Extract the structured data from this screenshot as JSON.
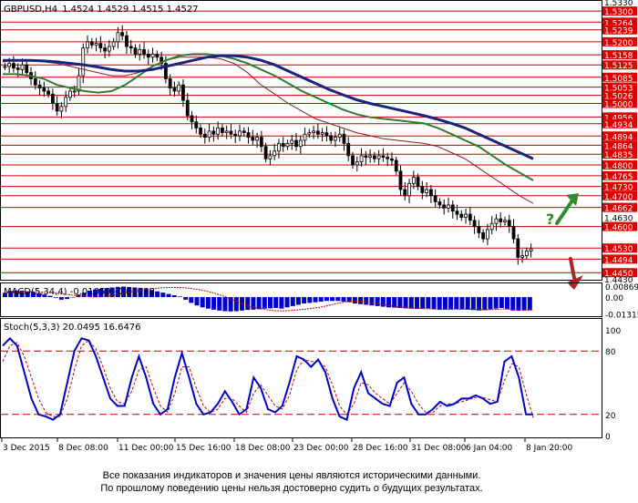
{
  "header": {
    "symbol": "GBPUSD,H4",
    "ohlc": "1.4524 1.4529 1.4515 1.4527"
  },
  "colors": {
    "frame": "#000000",
    "level_line": "#cc0000",
    "label_fill": "#dd0000",
    "label_text": "#ffffff",
    "candle": "#000000",
    "ma_fast": "#8b1a1a",
    "ma_mid": "#2e7d32",
    "ma_slow": "#1a237e",
    "macd_hist": "#0000cc",
    "macd_signal": "#cc0000",
    "stoch_main": "#0000cc",
    "stoch_signal": "#cc0000",
    "arrow_up": "#2e8b2e",
    "arrow_down": "#b22222"
  },
  "icons": {
    "up_forecast": "question-up-arrow-icon",
    "down_forecast": "down-arrow-icon"
  },
  "chart_data": [
    {
      "type": "candlestick",
      "title": "GBPUSD,H4",
      "ylim": [
        1.443,
        1.533
      ],
      "resistance_levels": [
        1.53,
        1.5264,
        1.5239,
        1.52,
        1.5158,
        1.5125,
        1.5085,
        1.5053,
        1.5026,
        1.5,
        1.4956,
        1.4934,
        1.4894,
        1.4864,
        1.4835,
        1.48,
        1.4765,
        1.473,
        1.47,
        1.4662,
        1.46,
        1.453,
        1.4494,
        1.445
      ],
      "price_labels": [
        "1.5330",
        "1.5300",
        "1.5264",
        "1.5239",
        "1.5200",
        "1.5158",
        "1.5125",
        "1.5085",
        "1.5053",
        "1.5026",
        "1.5000",
        "1.4956",
        "1.4934",
        "1.4894",
        "1.4864",
        "1.4835",
        "1.4800",
        "1.4765",
        "1.4730",
        "1.4700",
        "1.4662",
        "1.4630",
        "1.4600",
        "1.4530",
        "1.4494",
        "1.4450",
        "1.4430"
      ],
      "x_labels": [
        "3 Dec 2015",
        "8 Dec 08:00",
        "11 Dec 00:00",
        "15 Dec 16:00",
        "18 Dec 08:00",
        "23 Dec 00:00",
        "28 Dec 16:00",
        "31 Dec 08:00",
        "6 Jan 04:00",
        "8 Jan 20:00"
      ],
      "close_path": [
        1.512,
        1.513,
        1.5115,
        1.511,
        1.5125,
        1.51,
        1.508,
        1.506,
        1.505,
        1.504,
        1.503,
        1.5,
        1.4975,
        1.499,
        1.502,
        1.504,
        1.504,
        1.509,
        1.518,
        1.52,
        1.519,
        1.5195,
        1.518,
        1.517,
        1.5185,
        1.52,
        1.523,
        1.522,
        1.5185,
        1.518,
        1.516,
        1.5175,
        1.516,
        1.515,
        1.516,
        1.515,
        1.513,
        1.508,
        1.505,
        1.504,
        1.506,
        1.501,
        1.496,
        1.494,
        1.492,
        1.49,
        1.489,
        1.491,
        1.49,
        1.492,
        1.4905,
        1.491,
        1.49,
        1.4895,
        1.491,
        1.4905,
        1.489,
        1.488,
        1.489,
        1.486,
        1.482,
        1.483,
        1.4845,
        1.487,
        1.486,
        1.487,
        1.488,
        1.486,
        1.488,
        1.49,
        1.4905,
        1.491,
        1.49,
        1.4905,
        1.4895,
        1.488,
        1.489,
        1.49,
        1.487,
        1.483,
        1.48,
        1.481,
        1.483,
        1.4825,
        1.483,
        1.482,
        1.483,
        1.4825,
        1.482,
        1.4815,
        1.478,
        1.472,
        1.47,
        1.474,
        1.476,
        1.473,
        1.471,
        1.472,
        1.47,
        1.468,
        1.467,
        1.466,
        1.467,
        1.465,
        1.464,
        1.463,
        1.464,
        1.462,
        1.46,
        1.458,
        1.456,
        1.459,
        1.461,
        1.4625,
        1.4615,
        1.462,
        1.46,
        1.456,
        1.45,
        1.4505,
        1.452,
        1.4527
      ],
      "series": [
        {
          "name": "",
          "values": [
            1.5135,
            1.514,
            1.514,
            1.5135,
            1.513,
            1.512,
            1.511,
            1.51,
            1.509,
            1.509,
            1.51,
            1.512,
            1.514,
            1.515,
            1.515,
            1.515,
            1.5145,
            1.513,
            1.51,
            1.506,
            1.503,
            1.5,
            1.4975,
            1.495,
            1.4935,
            1.492,
            1.4905,
            1.4895,
            1.4885,
            1.488,
            1.4875,
            1.487,
            1.486,
            1.484,
            1.482,
            1.479,
            1.476,
            1.473,
            1.47,
            1.4675
          ]
        },
        {
          "name": "",
          "values": [
            1.5095,
            1.5095,
            1.509,
            1.508,
            1.506,
            1.505,
            1.504,
            1.5035,
            1.504,
            1.506,
            1.509,
            1.512,
            1.514,
            1.5155,
            1.516,
            1.516,
            1.5155,
            1.5145,
            1.513,
            1.511,
            1.509,
            1.5065,
            1.504,
            1.502,
            1.5,
            1.498,
            1.4965,
            1.4955,
            1.495,
            1.4945,
            1.494,
            1.4935,
            1.492,
            1.49,
            1.488,
            1.486,
            1.483,
            1.48,
            1.4775,
            1.475
          ]
        },
        {
          "name": "",
          "values": [
            1.514,
            1.514,
            1.514,
            1.5138,
            1.5135,
            1.513,
            1.5125,
            1.5118,
            1.511,
            1.5105,
            1.5105,
            1.511,
            1.512,
            1.513,
            1.514,
            1.515,
            1.5155,
            1.5155,
            1.515,
            1.514,
            1.5125,
            1.5105,
            1.5085,
            1.5065,
            1.5045,
            1.5028,
            1.5012,
            1.5,
            1.499,
            1.498,
            1.497,
            1.496,
            1.4948,
            1.4935,
            1.492,
            1.49,
            1.488,
            1.486,
            1.484,
            1.482
          ]
        }
      ]
    },
    {
      "type": "bar",
      "title": "MACD(5,34,4) -0.01059 -0.01038",
      "ylim": [
        -0.0142,
        0.01
      ],
      "tick_labels": [
        "0.00869",
        "0.00",
        "-0.01315"
      ],
      "values": [
        0.003,
        0.0048,
        0.0052,
        0.005,
        0.0045,
        0.004,
        0.003,
        0.002,
        0.001,
        -0.0005,
        -0.002,
        -0.0015,
        0.0,
        0.002,
        0.0035,
        0.005,
        0.006,
        0.0065,
        0.007,
        0.0075,
        0.008,
        0.0082,
        0.0079,
        0.0075,
        0.0072,
        0.0065,
        0.0055,
        0.0045,
        0.0035,
        0.0025,
        0.0015,
        0.0005,
        -0.002,
        -0.0045,
        -0.0065,
        -0.008,
        -0.009,
        -0.0098,
        -0.0105,
        -0.011,
        -0.0112,
        -0.011,
        -0.0105,
        -0.01,
        -0.0098,
        -0.0095,
        -0.009,
        -0.0088,
        -0.0085,
        -0.009,
        -0.008,
        -0.007,
        -0.006,
        -0.005,
        -0.0045,
        -0.004,
        -0.0035,
        -0.003,
        -0.003,
        -0.003,
        -0.0035,
        -0.004,
        -0.005,
        -0.0055,
        -0.006,
        -0.0065,
        -0.007,
        -0.0075,
        -0.008,
        -0.0082,
        -0.0085,
        -0.0088,
        -0.009,
        -0.0092,
        -0.009,
        -0.0088,
        -0.0095,
        -0.01,
        -0.0098,
        -0.0095,
        -0.0092,
        -0.0095,
        -0.0098,
        -0.0102,
        -0.0105,
        -0.01,
        -0.0095,
        -0.009,
        -0.0085,
        -0.0095,
        -0.0105,
        -0.0106,
        -0.0104,
        -0.01
      ],
      "signal": [
        0.003,
        0.0035,
        0.004,
        0.0042,
        0.004,
        0.0035,
        0.0028,
        0.002,
        0.0012,
        0.0005,
        0.0,
        0.0005,
        0.0015,
        0.003,
        0.0045,
        0.0058,
        0.0066,
        0.0072,
        0.0075,
        0.0075,
        0.007,
        0.006,
        0.0045,
        0.0025,
        0.0,
        -0.003,
        -0.006,
        -0.008,
        -0.0095,
        -0.0105,
        -0.0108,
        -0.0105,
        -0.0098,
        -0.009,
        -0.008,
        -0.0065,
        -0.0048,
        -0.0035,
        -0.003,
        -0.0035,
        -0.0045,
        -0.006,
        -0.0072,
        -0.008,
        -0.0086,
        -0.009,
        -0.0092,
        -0.0095,
        -0.0097,
        -0.0096,
        -0.0094,
        -0.0098,
        -0.01,
        -0.0096,
        -0.0092,
        -0.0097,
        -0.0102,
        -0.0104
      ]
    },
    {
      "type": "line",
      "title": "Stoch(5,3,3) 20.0495 16.6476",
      "ylim": [
        0,
        100
      ],
      "tick_labels": [
        "100",
        "80",
        "20",
        "0"
      ],
      "reference_levels": [
        80,
        20
      ],
      "series": [
        {
          "name": "",
          "values": [
            85,
            92,
            85,
            60,
            35,
            20,
            18,
            15,
            20,
            50,
            80,
            92,
            90,
            75,
            55,
            35,
            28,
            28,
            55,
            75,
            55,
            30,
            20,
            25,
            55,
            78,
            55,
            30,
            20,
            22,
            30,
            42,
            32,
            20,
            25,
            55,
            45,
            25,
            22,
            28,
            50,
            75,
            72,
            65,
            72,
            60,
            35,
            18,
            15,
            45,
            60,
            40,
            35,
            30,
            28,
            50,
            55,
            30,
            20,
            20,
            25,
            32,
            28,
            30,
            35,
            35,
            38,
            35,
            30,
            32,
            70,
            75,
            55,
            20,
            20
          ]
        },
        {
          "name": "",
          "values": [
            70,
            85,
            88,
            75,
            55,
            35,
            22,
            18,
            18,
            35,
            62,
            85,
            90,
            82,
            65,
            45,
            32,
            30,
            42,
            62,
            65,
            45,
            28,
            22,
            40,
            65,
            65,
            45,
            28,
            22,
            25,
            35,
            35,
            28,
            22,
            40,
            48,
            38,
            28,
            25,
            38,
            62,
            72,
            70,
            70,
            65,
            48,
            28,
            20,
            30,
            50,
            48,
            40,
            35,
            30,
            40,
            50,
            42,
            30,
            22,
            22,
            28,
            30,
            30,
            32,
            34,
            36,
            36,
            34,
            32,
            52,
            68,
            65,
            40,
            17
          ]
        }
      ]
    }
  ],
  "disclaimer": {
    "line1": "Все показания индикаторов и значения цены являются историческими данными.",
    "line2": "По прошлому поведению цены нельзя достоверно судить о будущих результатах."
  }
}
